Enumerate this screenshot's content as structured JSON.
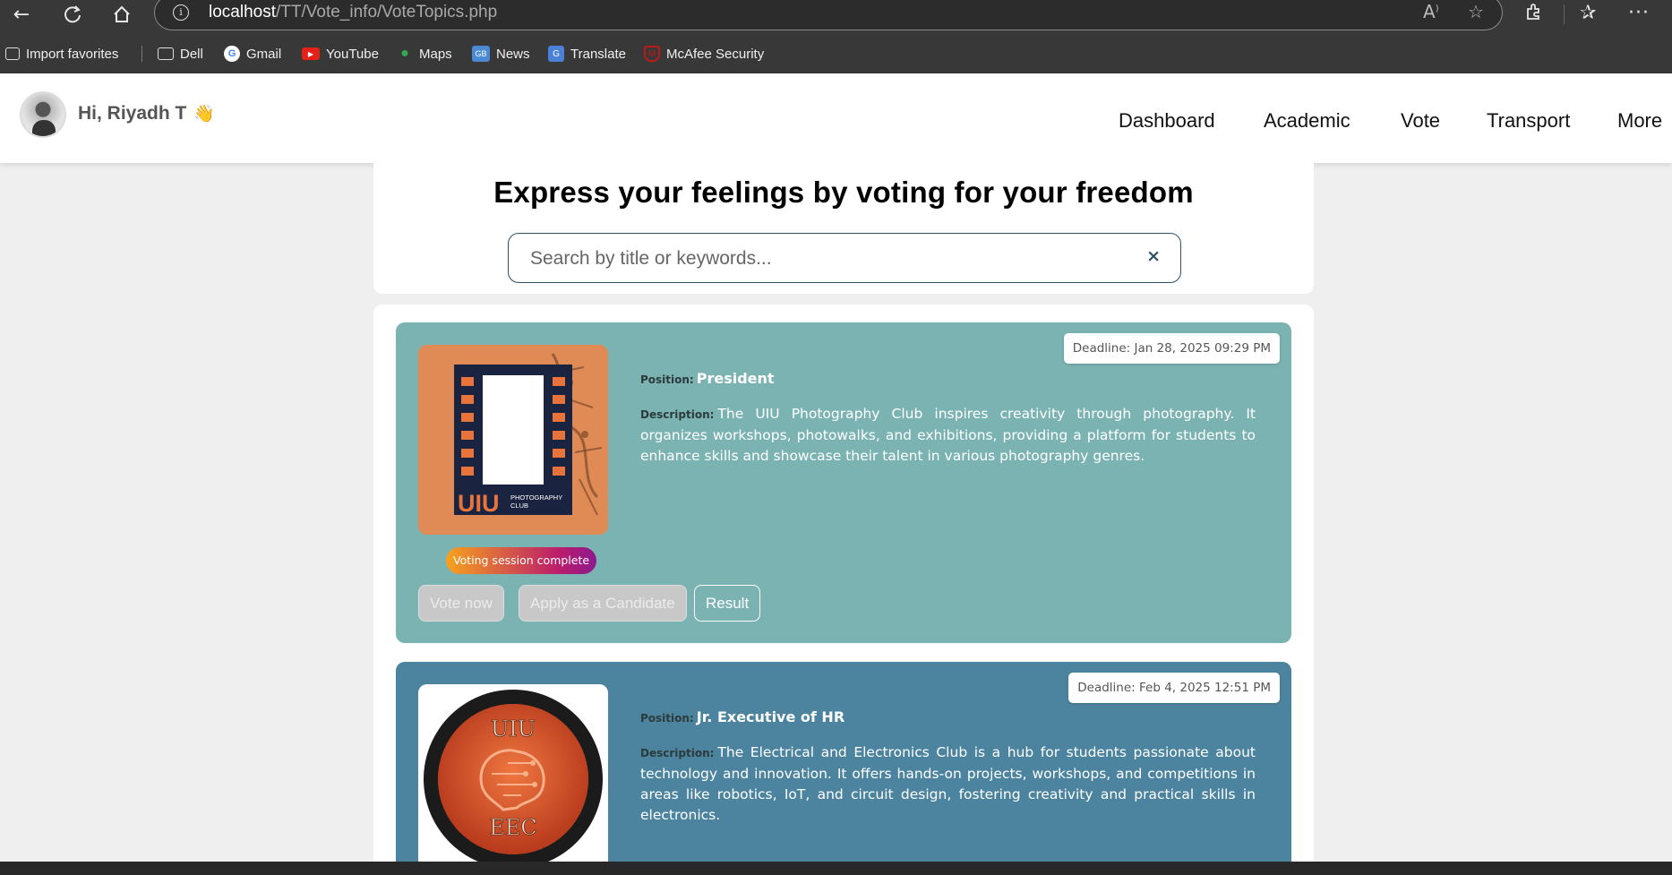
{
  "browser": {
    "url_host": "localhost",
    "url_path": "/TT/Vote_info/VoteTopics.php",
    "bookmarks": [
      {
        "label": "Import favorites",
        "icon": "import-icon"
      },
      {
        "label": "Dell",
        "icon": "folder-icon"
      },
      {
        "label": "Gmail",
        "icon": "google-icon"
      },
      {
        "label": "YouTube",
        "icon": "youtube-icon"
      },
      {
        "label": "Maps",
        "icon": "maps-icon"
      },
      {
        "label": "News",
        "icon": "news-icon"
      },
      {
        "label": "Translate",
        "icon": "translate-icon"
      },
      {
        "label": "McAfee Security",
        "icon": "mcafee-icon"
      }
    ]
  },
  "header": {
    "greeting": "Hi, Riyadh T",
    "wave": "👋",
    "nav": [
      "Dashboard",
      "Academic",
      "Vote",
      "Transport",
      "More"
    ]
  },
  "hero": {
    "title": "Express your feelings by voting for your freedom",
    "search_placeholder": "Search by title or keywords...",
    "clear": "×"
  },
  "topics": [
    {
      "deadline": "Deadline: Jan 28, 2025 09:29 PM",
      "position_label": "Position:",
      "position": "President",
      "description_label": "Description:",
      "description": "The UIU Photography Club inspires creativity through photography. It organizes workshops, photowalks, and exhibitions, providing a platform for students to enhance skills and showcase their talent in various photography genres.",
      "status": "Voting session complete",
      "logo_text": "UIU",
      "logo_sub": "PHOTOGRAPHY CLUB",
      "buttons": [
        "Vote now",
        "Apply as a Candidate",
        "Result"
      ],
      "color": "#7bb3b2"
    },
    {
      "deadline": "Deadline: Feb 4, 2025 12:51 PM",
      "position_label": "Position:",
      "position": "Jr. Executive of HR",
      "description_label": "Description:",
      "description": "The Electrical and Electronics Club is a hub for students passionate about technology and innovation. It offers hands-on projects, workshops, and competitions in areas like robotics, IoT, and circuit design, fostering creativity and practical skills in electronics.",
      "logo_text": "UIU",
      "logo_sub": "EEC",
      "color": "#4c849f"
    }
  ]
}
